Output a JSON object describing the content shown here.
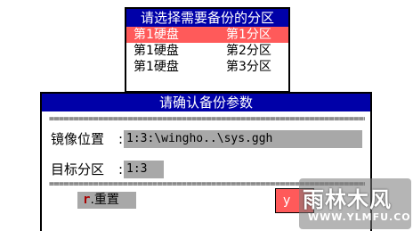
{
  "menu": {
    "title": "请选择需要备份的分区",
    "items": [
      {
        "disk": "第1硬盘",
        "partition": "第1分区",
        "selected": true
      },
      {
        "disk": "第1硬盘",
        "partition": "第2分区",
        "selected": false
      },
      {
        "disk": "第1硬盘",
        "partition": "第3分区",
        "selected": false
      }
    ]
  },
  "dialog": {
    "title": "请确认备份参数",
    "separator": "=================================================================",
    "image_location_label": "镜像位置",
    "image_location_value": "1:3:\\wingho..\\sys.ggh",
    "target_partition_label": "目标分区",
    "target_partition_value": "1:3",
    "colon": ":",
    "reset_hotkey": "r",
    "reset_label": ".重置",
    "ok_button_label": "y"
  },
  "watermark": {
    "brand": "雨林木风",
    "url": "WWW.YLMFU.COM"
  },
  "colors": {
    "title_bar": "#0000a8",
    "highlight": "#ff5a5a",
    "field_bg": "#a8a8a8"
  }
}
